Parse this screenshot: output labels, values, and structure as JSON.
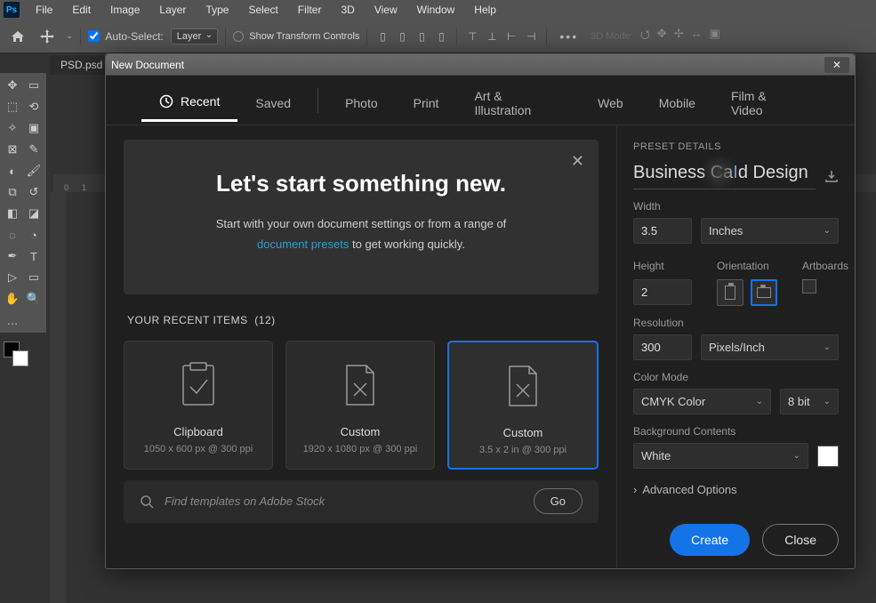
{
  "menubar": [
    "File",
    "Edit",
    "Image",
    "Layer",
    "Type",
    "Select",
    "Filter",
    "3D",
    "View",
    "Window",
    "Help"
  ],
  "options": {
    "auto_select": "Auto-Select:",
    "layer_dd": "Layer",
    "show_transform": "Show Transform Controls",
    "mode3d": "3D Mode:"
  },
  "doc_tab": "PSD.psd",
  "dialog": {
    "title": "New Document",
    "tabs": {
      "recent": "Recent",
      "saved": "Saved",
      "photo": "Photo",
      "print": "Print",
      "art": "Art & Illustration",
      "web": "Web",
      "mobile": "Mobile",
      "film": "Film & Video"
    },
    "intro": {
      "title": "Let's start something new.",
      "body_pre": "Start with your own document settings or from a range of ",
      "body_link": "document presets",
      "body_post": " to get working quickly."
    },
    "recent_label": "YOUR RECENT ITEMS",
    "recent_count": "(12)",
    "cards": [
      {
        "title": "Clipboard",
        "meta": "1050 x 600 px @ 300 ppi"
      },
      {
        "title": "Custom",
        "meta": "1920 x 1080 px @ 300 ppi"
      },
      {
        "title": "Custom",
        "meta": "3.5 x 2 in @ 300 ppi"
      }
    ],
    "stock": {
      "placeholder": "Find templates on Adobe Stock",
      "go": "Go"
    }
  },
  "details": {
    "heading": "PRESET DETAILS",
    "title_pre": "Business Ca",
    "title_post": "d Design",
    "width_label": "Width",
    "width_value": "3.5",
    "unit": "Inches",
    "height_label": "Height",
    "height_value": "2",
    "orientation_label": "Orientation",
    "artboards_label": "Artboards",
    "resolution_label": "Resolution",
    "resolution_value": "300",
    "resolution_unit": "Pixels/Inch",
    "colormode_label": "Color Mode",
    "colormode_value": "CMYK Color",
    "bitdepth": "8 bit",
    "bg_label": "Background Contents",
    "bg_value": "White",
    "advanced": "Advanced Options",
    "create": "Create",
    "close": "Close"
  }
}
